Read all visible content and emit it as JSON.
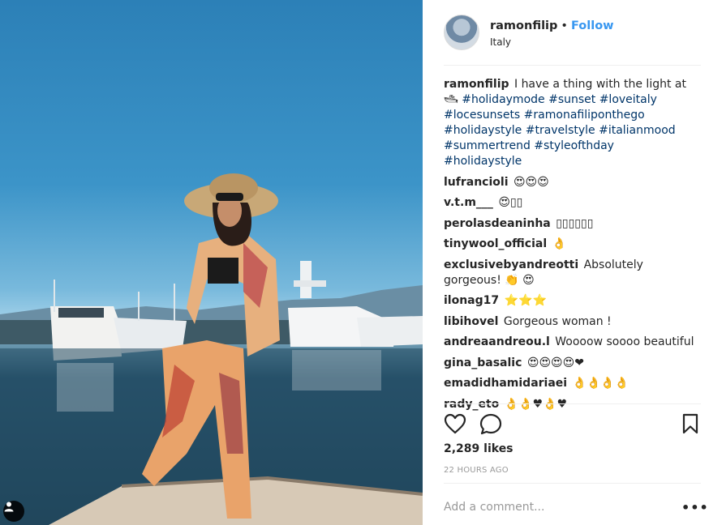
{
  "post": {
    "author": {
      "username": "ramonfilip",
      "separator": "•",
      "follow_label": "Follow",
      "location": "Italy"
    },
    "caption": {
      "author": "ramonfilip",
      "text": "I have a thing with the light at 🛥",
      "hashtags": "#holidaymode #sunset #loveitaly #locesunsets #ramonafiliponthego #holidaystyle #travelstyle #italianmood #summertrend #styleofthday #holidaystyle"
    },
    "comments": [
      {
        "author": "lufrancioli",
        "text": "😍😍😍"
      },
      {
        "author": "v.t.m___",
        "text": "😍▯▯"
      },
      {
        "author": "perolasdeaninha",
        "text": "▯▯▯▯▯▯"
      },
      {
        "author": "tinywool_official",
        "text": "👌"
      },
      {
        "author": "exclusivebyandreotti",
        "text": "Absolutely gorgeous! 👏 😍"
      },
      {
        "author": "ilonag17",
        "text": "⭐⭐⭐"
      },
      {
        "author": "libihovel",
        "text": "Gorgeous woman !"
      },
      {
        "author": "andreaandreou.l",
        "text": "Woooow soooo beautiful"
      },
      {
        "author": "gina_basalic",
        "text": "😍😍😍😍❤"
      },
      {
        "author": "emadidhamidariaei",
        "text": "👌👌👌👌"
      },
      {
        "author": "rady_eto",
        "text": "👌👌♥👌♥"
      }
    ],
    "likes": "2,289 likes",
    "timestamp": "22 HOURS AGO",
    "comment_placeholder": "Add a comment...",
    "more_label": "•••",
    "icons": {
      "like": "heart-icon",
      "comment": "speech-bubble-icon",
      "save": "bookmark-icon",
      "user_tags": "person-icon"
    },
    "colors": {
      "follow": "#3897f0",
      "hashtag": "#003569",
      "muted": "#999999",
      "divider": "#efefef"
    }
  }
}
